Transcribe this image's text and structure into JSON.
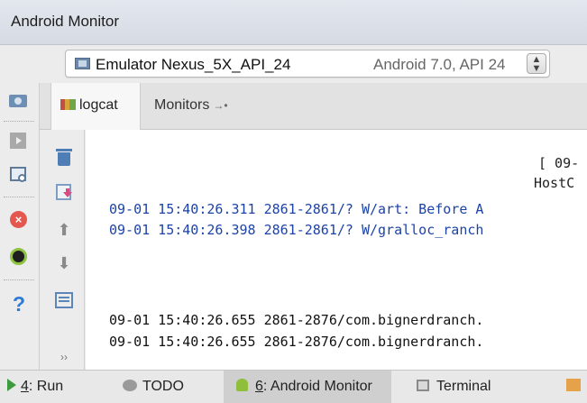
{
  "window": {
    "title": "Android Monitor"
  },
  "device_selector": {
    "device_name": "Emulator Nexus_5X_API_24",
    "device_detail": "Android 7.0, API 24",
    "icon": "device-icon"
  },
  "side_toolbar": {
    "buttons": [
      "screen-capture-icon",
      "screen-record-icon",
      "system-info-icon",
      "terminate-app-icon",
      "layout-inspector-icon",
      "help-icon"
    ],
    "help_glyph": "?"
  },
  "tabs": [
    {
      "label": "logcat",
      "selected": true,
      "icon": "logcat-icon"
    },
    {
      "label": "Monitors",
      "selected": false,
      "icon": "restore-arrow-icon"
    }
  ],
  "logcat_toolbar": {
    "buttons": [
      "clear-logcat-icon",
      "scroll-to-end-icon",
      "up-arrow-icon",
      "down-arrow-icon",
      "soft-wraps-icon",
      "more-icon"
    ],
    "up_glyph": "⬆",
    "down_glyph": "⬇",
    "more_glyph": "››"
  },
  "log": {
    "header_line1": "[ 09-",
    "header_line2": "HostC",
    "warn_line1": "09-01 15:40:26.311 2861-2861/? W/art: Before A",
    "warn_line2": "09-01 15:40:26.398 2861-2861/? W/gralloc_ranch",
    "debug_line1": "09-01 15:40:26.655 2861-2876/com.bignerdranch.",
    "debug_line2": "09-01 15:40:26.655 2861-2876/com.bignerdranch."
  },
  "bottom_bar": {
    "run_number": "4",
    "run_label": ": Run",
    "todo_label": "TODO",
    "monitor_number": "6",
    "monitor_label": ": Android Monitor",
    "terminal_label": "Terminal"
  },
  "colors": {
    "warn_text": "#1d43a6",
    "selected_tool_window": "#cfcfcf",
    "android_green": "#8fbf3a"
  }
}
